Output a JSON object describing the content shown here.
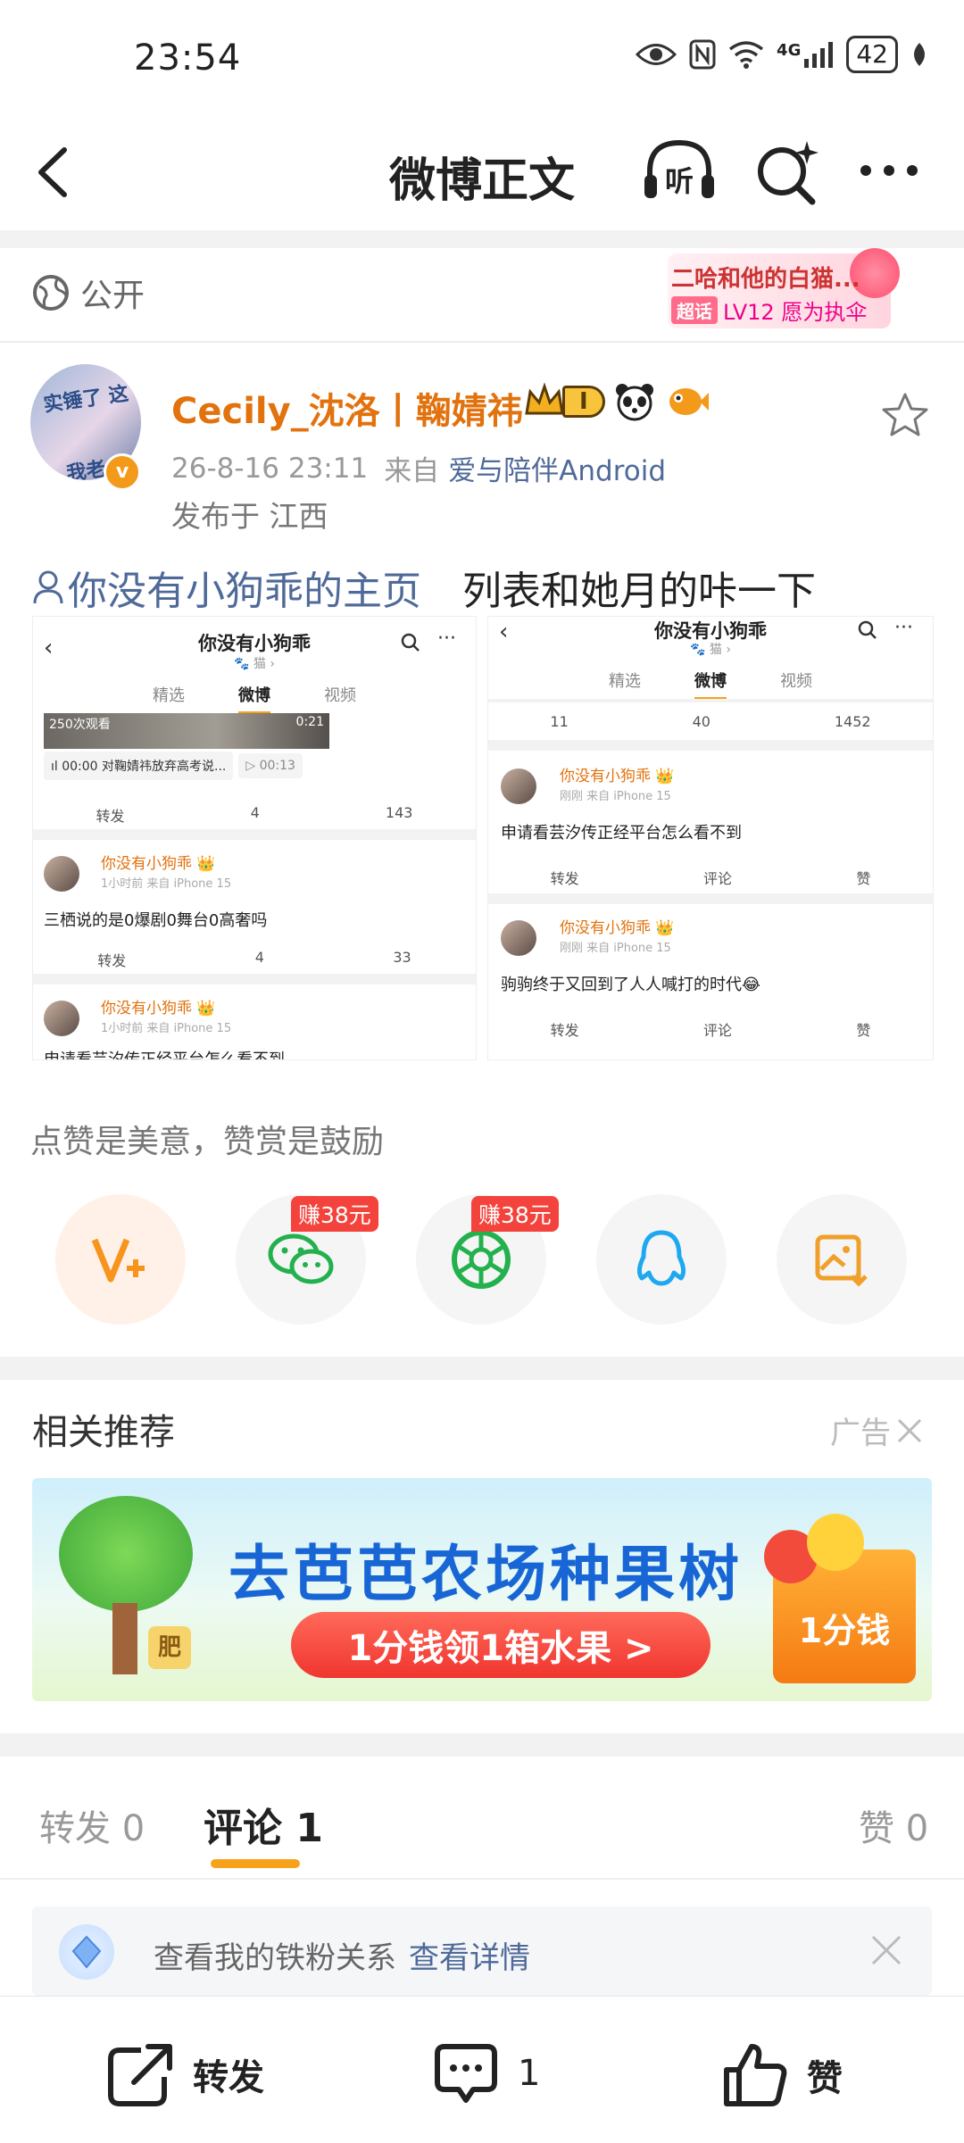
{
  "status_bar": {
    "time": "23:54",
    "battery": "42",
    "network": "4G"
  },
  "nav": {
    "title": "微博正文",
    "listen_label": "听"
  },
  "visibility": {
    "label": "公开"
  },
  "super_topic": {
    "title": "二哈和他的白猫...",
    "tag": "超话",
    "level": "LV12 愿为执伞"
  },
  "author": {
    "name": "Cecily_沈洛丨鞠婧祎",
    "member_badge": "I",
    "date": "26-8-16 23:11",
    "source_prefix": "来自",
    "source": "爱与陪伴Android",
    "location": "发布于 江西",
    "avatar_text": "实锤了 这我老人"
  },
  "post": {
    "mention": "你没有小狗乖的主页",
    "body": "列表和她月的咔一下"
  },
  "screenshot_left": {
    "title": "你没有小狗乖",
    "subtitle": "🐾 猫 ›",
    "tabs": [
      "精选",
      "微博",
      "视频"
    ],
    "top_image_caption": "250次观看",
    "top_image_time": "0:21",
    "audio_text": "ıl 00:00 对鞠婧祎放弃高考说...",
    "audio_time": "▷ 00:13",
    "actions1": [
      "转发",
      "4",
      "143"
    ],
    "post1": {
      "name": "你没有小狗乖 👑",
      "meta": "1小时前  来自 iPhone 15",
      "text": "三栖说的是0爆剧0舞台0高奢吗",
      "actions": [
        "转发",
        "4",
        "33"
      ]
    },
    "post2": {
      "name": "你没有小狗乖 👑",
      "meta": "1小时前  来自 iPhone 15",
      "text": "申请看芸汐传正经平台怎么看不到"
    }
  },
  "screenshot_right": {
    "title": "你没有小狗乖",
    "subtitle": "🐾 猫 ›",
    "tabs": [
      "精选",
      "微博",
      "视频"
    ],
    "actions0": [
      "11",
      "40",
      "1452"
    ],
    "post1": {
      "name": "你没有小狗乖 👑",
      "meta": "刚刚  来自 iPhone 15",
      "text": "申请看芸汐传正经平台怎么看不到",
      "actions": [
        "转发",
        "评论",
        "赞"
      ]
    },
    "post2": {
      "name": "你没有小狗乖 👑",
      "meta": "刚刚  来自 iPhone 15",
      "text": "驹驹终于又回到了人人喊打的时代😂",
      "actions": [
        "转发",
        "评论",
        "赞"
      ]
    }
  },
  "support": {
    "text": "点赞是美意，赞赏是鼓励",
    "earn_tag": "赚38元"
  },
  "recommend": {
    "title": "相关推荐",
    "ad_label": "广告",
    "ad_headline": "去芭芭农场种果树",
    "ad_button": "1分钱领1箱水果 >",
    "ad_tag": "1分钱",
    "ad_fertilizer": "肥"
  },
  "tabs": {
    "repost": "转发 0",
    "comment": "评论 1",
    "like": "赞 0"
  },
  "fans_tip": {
    "text": "查看我的铁粉关系",
    "link": "查看详情"
  },
  "bottom_bar": {
    "repost": "转发",
    "comment_count": "1",
    "like": "赞"
  },
  "colors": {
    "accent": "#f7a21b",
    "name_orange": "#e2720e",
    "link_blue": "#4f6a99",
    "earn_red": "#f4433c"
  }
}
